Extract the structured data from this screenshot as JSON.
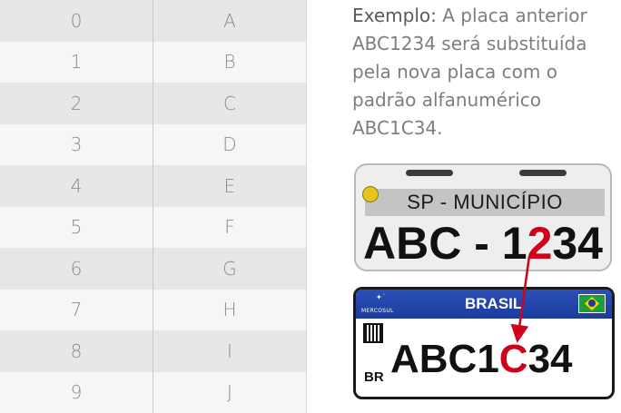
{
  "table": {
    "rows": [
      {
        "digit": "0",
        "letter": "A"
      },
      {
        "digit": "1",
        "letter": "B"
      },
      {
        "digit": "2",
        "letter": "C"
      },
      {
        "digit": "3",
        "letter": "D"
      },
      {
        "digit": "4",
        "letter": "E"
      },
      {
        "digit": "5",
        "letter": "F"
      },
      {
        "digit": "6",
        "letter": "G"
      },
      {
        "digit": "7",
        "letter": "H"
      },
      {
        "digit": "8",
        "letter": "I"
      },
      {
        "digit": "9",
        "letter": "J"
      }
    ]
  },
  "caption": {
    "lead": "Exemplo:",
    "text": " A placa anterior ABC1234 será substituída pela nova placa com o padrão alfanumérico ABC1C34."
  },
  "old_plate": {
    "header": "SP - MUNICÍPIO",
    "number_prefix": "ABC - 1",
    "number_highlight": "2",
    "number_suffix": "34"
  },
  "new_plate": {
    "bloc": "MERCOSUL",
    "country": "BRASIL",
    "country_code": "BR",
    "number_prefix": "ABC1",
    "number_highlight": "C",
    "number_suffix": "34"
  },
  "colors": {
    "highlight": "#d0021b",
    "mercosul_blue": "#1d3d9c",
    "table_odd": "#e7e7e7",
    "table_even": "#f6f6f6"
  }
}
